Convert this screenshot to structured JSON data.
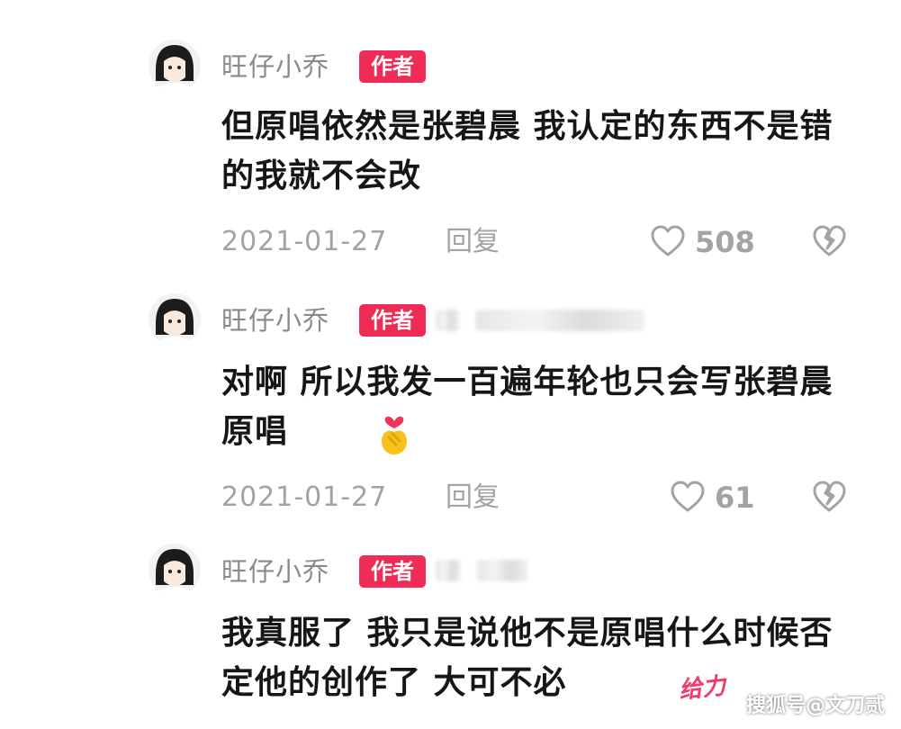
{
  "comments": [
    {
      "username": "旺仔小乔",
      "badge": "作者",
      "text": "但原唱依然是张碧晨 我认定的东西不是错的我就不会改",
      "date": "2021-01-27",
      "reply_label": "回复",
      "likes": "508",
      "like_icon": "heart-outline-icon",
      "dislike_icon": "broken-heart-icon"
    },
    {
      "username": "旺仔小乔",
      "badge": "作者",
      "text": "对啊 所以我发一百遍年轮也只会写张碧晨原唱",
      "emoji": "finger-heart-emoji",
      "date": "2021-01-27",
      "reply_label": "回复",
      "likes": "61",
      "like_icon": "heart-outline-icon",
      "dislike_icon": "broken-heart-icon"
    },
    {
      "username": "旺仔小乔",
      "badge": "作者",
      "text": "我真服了 我只是说他不是原唱什么时候否定他的创作了 大可不必",
      "sticker": "给力"
    }
  ],
  "watermark": "搜狐号@文刀贰",
  "colors": {
    "badge_bg": "#ee2c55",
    "muted_text": "#a3a3a3",
    "username_text": "#8a8a8a",
    "body_text": "#161616"
  }
}
